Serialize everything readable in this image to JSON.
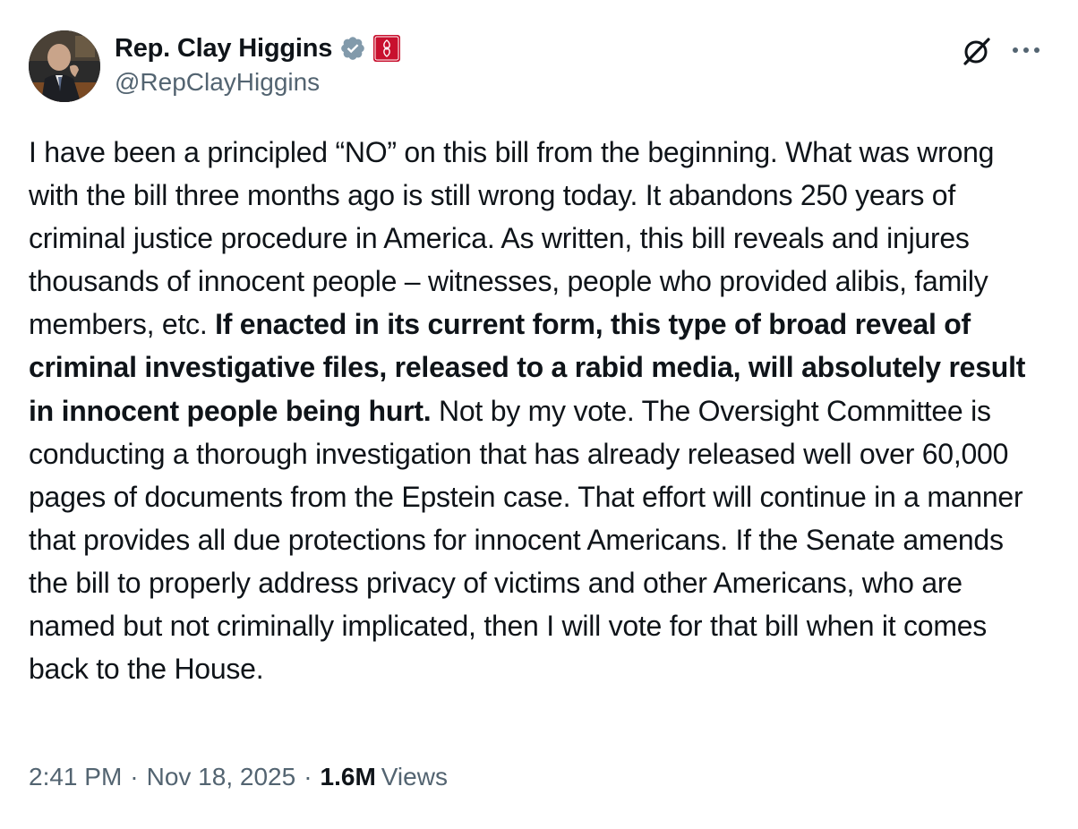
{
  "author": {
    "display_name": "Rep. Clay Higgins",
    "handle": "@RepClayHiggins",
    "avatar_icon": "profile-photo",
    "verified_icon": "verified-badge-icon",
    "affiliation_icon": "us-house-affiliation-icon",
    "verified_color": "#829aab",
    "affiliation_color": "#c8102e"
  },
  "actions": {
    "grok_icon": "grok-icon",
    "more_icon": "more-options-icon"
  },
  "tweet": {
    "part1": "I have been a principled “NO” on this bill from the beginning. What was wrong with the bill three months ago is still wrong today. It abandons 250 years of criminal justice procedure in America. As written, this bill reveals and injures thousands of innocent people – witnesses, people who provided alibis, family members, etc. ",
    "part2_bold": "If enacted in its current form, this type of broad reveal of criminal investigative files, released to a rabid media, will absolutely result in innocent people being hurt.",
    "part3": " Not by my vote. The Oversight Committee is conducting a thorough investigation that has already released well over 60,000 pages of documents from the Epstein case. That effort will continue in a manner that provides all due protections for innocent Americans. If the Senate amends the bill to properly address privacy of victims and other Americans, who are named but not criminally implicated, then I will vote for that bill when it comes back to the House."
  },
  "meta": {
    "time": "2:41 PM",
    "separator": "·",
    "date": "Nov 18, 2025",
    "views_count": "1.6M",
    "views_label": "Views"
  }
}
